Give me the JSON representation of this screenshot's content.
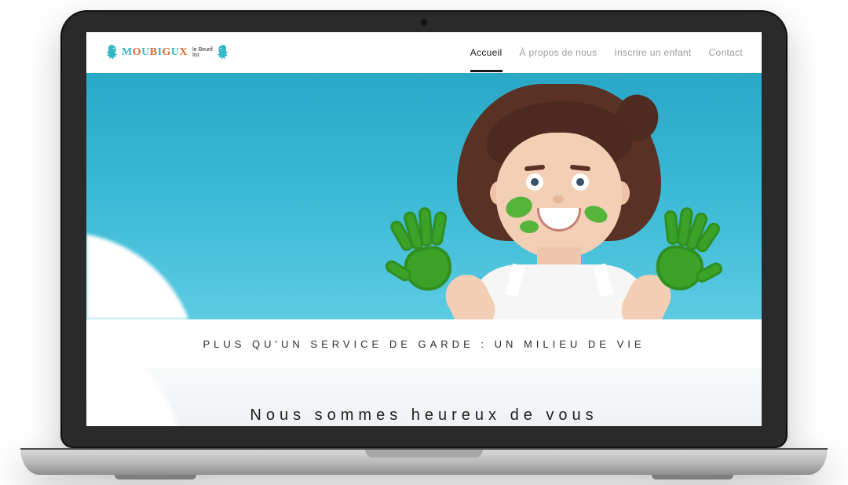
{
  "logo": {
    "word_colored": "MOUBIGUX",
    "subline1": "le Beurif",
    "subline2": "list"
  },
  "nav": {
    "items": [
      {
        "label": "Accueil",
        "active": true
      },
      {
        "label": "À propos de nous",
        "active": false
      },
      {
        "label": "Inscrire un enfant",
        "active": false
      },
      {
        "label": "Contact",
        "active": false
      }
    ]
  },
  "tagline": "PLUS QU'UN SERVICE DE GARDE : UN MILIEU DE VIE",
  "welcome_heading": "Nous sommes heureux de vous"
}
